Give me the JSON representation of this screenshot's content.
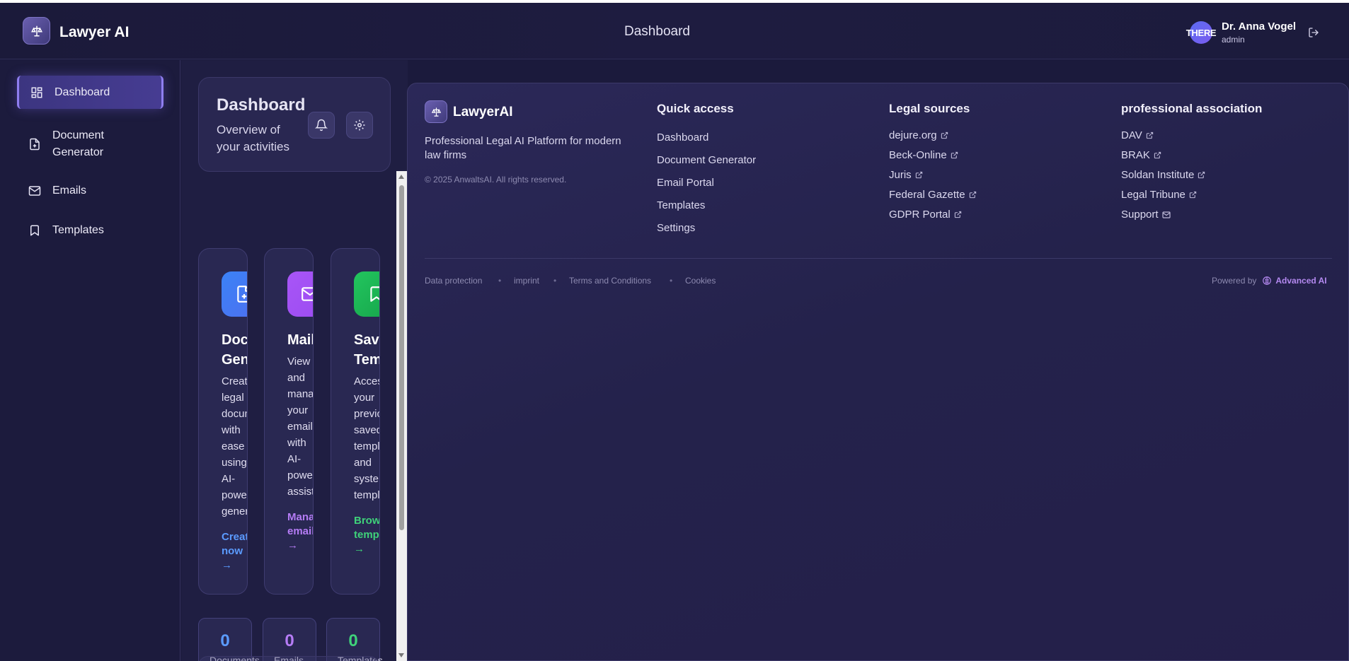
{
  "header": {
    "app_name": "Lawyer AI",
    "page_title": "Dashboard",
    "user": {
      "avatar_text": "THERE",
      "name": "Dr. Anna Vogel",
      "role": "admin"
    }
  },
  "sidebar": {
    "items": [
      {
        "label": "Dashboard",
        "icon": "dashboard-grid-icon",
        "active": true
      },
      {
        "label": "Document\nGenerator",
        "icon": "file-plus-icon",
        "active": false
      },
      {
        "label": "Emails",
        "icon": "mail-icon",
        "active": false
      },
      {
        "label": "Templates",
        "icon": "bookmark-icon",
        "active": false
      }
    ]
  },
  "dashboard": {
    "title": "Dashboard",
    "subtitle": "Overview of your activities",
    "cards": [
      {
        "title": "Docum\nGener",
        "desc": "Create\nlegal\ndocument\nwith\nease\nusing\nAI-\npowered\ngeneratio",
        "link": "Create\nnow\n→",
        "color": "#3b82f6",
        "link_color": "#5b9bff"
      },
      {
        "title": "Mailbo",
        "desc": "View\nand\nmanage\nyour\nemails\nwith\nAI-\npowered\nassistanc",
        "link": "Manage\nemails\n→",
        "color": "#a855f7",
        "link_color": "#b57cf5"
      },
      {
        "title": "Saved\nTempl",
        "desc": "Access\nyour\npreviousl\nsaved\ntemplates\nand\nsystem\ntemplates",
        "link": "Browse\ntemplates\n→",
        "color": "#22c55e",
        "link_color": "#3fd27a"
      }
    ],
    "stats": [
      {
        "value": "0",
        "label": "Documents\ncreated",
        "color": "#5b9bff"
      },
      {
        "value": "0",
        "label": "Emails\nprocessed",
        "color": "#b57cf5"
      },
      {
        "value": "0",
        "label": "Templates\nsaved",
        "color": "#3fd27a"
      }
    ]
  },
  "footer": {
    "brand": "LawyerAI",
    "tagline": "Professional Legal AI Platform for modern law firms",
    "copyright": "© 2025 AnwaltsAI. All rights reserved.",
    "columns": [
      {
        "title": "Quick access",
        "links": [
          "Dashboard",
          "Document Generator",
          "Email Portal",
          "Templates",
          "Settings"
        ]
      },
      {
        "title": "Legal sources",
        "links": [
          "dejure.org",
          "Beck-Online",
          "Juris",
          "Federal Gazette",
          "GDPR Portal"
        ]
      },
      {
        "title": "professional association",
        "links": [
          "DAV",
          "BRAK",
          "Soldan Institute",
          "Legal Tribune",
          "Support"
        ]
      }
    ],
    "bottom_links": [
      "Data protection",
      "imprint",
      "Terms and Conditions",
      "Cookies"
    ],
    "powered_by": "Powered by",
    "powered_brand": "Advanced AI"
  }
}
